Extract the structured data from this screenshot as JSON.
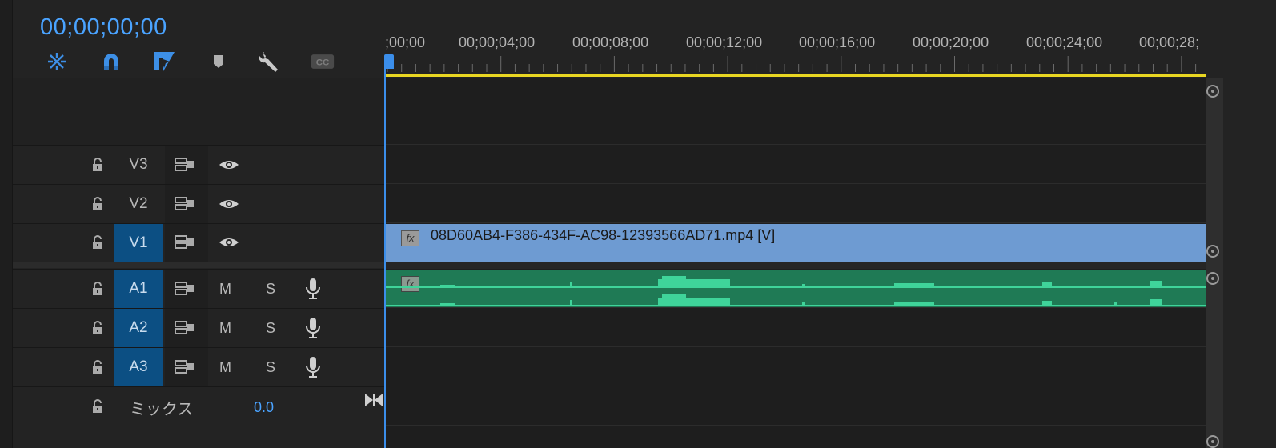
{
  "timecode": "00;00;00;00",
  "toolbar": {
    "icons": [
      "nest-sequence-icon",
      "snap-magnet-icon",
      "linked-selection-icon",
      "add-marker-icon",
      "wrench-settings-icon",
      "captions-cc-icon"
    ],
    "cc_label": "CC"
  },
  "ruler": {
    "labels": [
      ";00;00",
      "00;00;04;00",
      "00;00;08;00",
      "00;00;12;00",
      "00;00;16;00",
      "00;00;20;00",
      "00;00;24;00",
      "00;00;28;"
    ]
  },
  "tracks": {
    "video": [
      {
        "name": "V3",
        "targeted": false
      },
      {
        "name": "V2",
        "targeted": false
      },
      {
        "name": "V1",
        "targeted": true
      }
    ],
    "audio": [
      {
        "name": "A1",
        "targeted": true,
        "mute": "M",
        "solo": "S"
      },
      {
        "name": "A2",
        "targeted": true,
        "mute": "M",
        "solo": "S"
      },
      {
        "name": "A3",
        "targeted": true,
        "mute": "M",
        "solo": "S"
      }
    ],
    "mix": {
      "label": "ミックス",
      "value": "0.0"
    }
  },
  "clips": {
    "video": {
      "name": "08D60AB4-F386-434F-AC98-12393566AD71.mp4 [V]",
      "fx": "fx"
    },
    "audio": {
      "fx": "fx"
    }
  },
  "colors": {
    "accent": "#4aa3ff",
    "target_track": "#0c4f83",
    "video_clip": "#6e9bd2",
    "audio_clip": "#1f7a55",
    "work_area": "#e8d622",
    "playhead": "#3b8eea"
  }
}
